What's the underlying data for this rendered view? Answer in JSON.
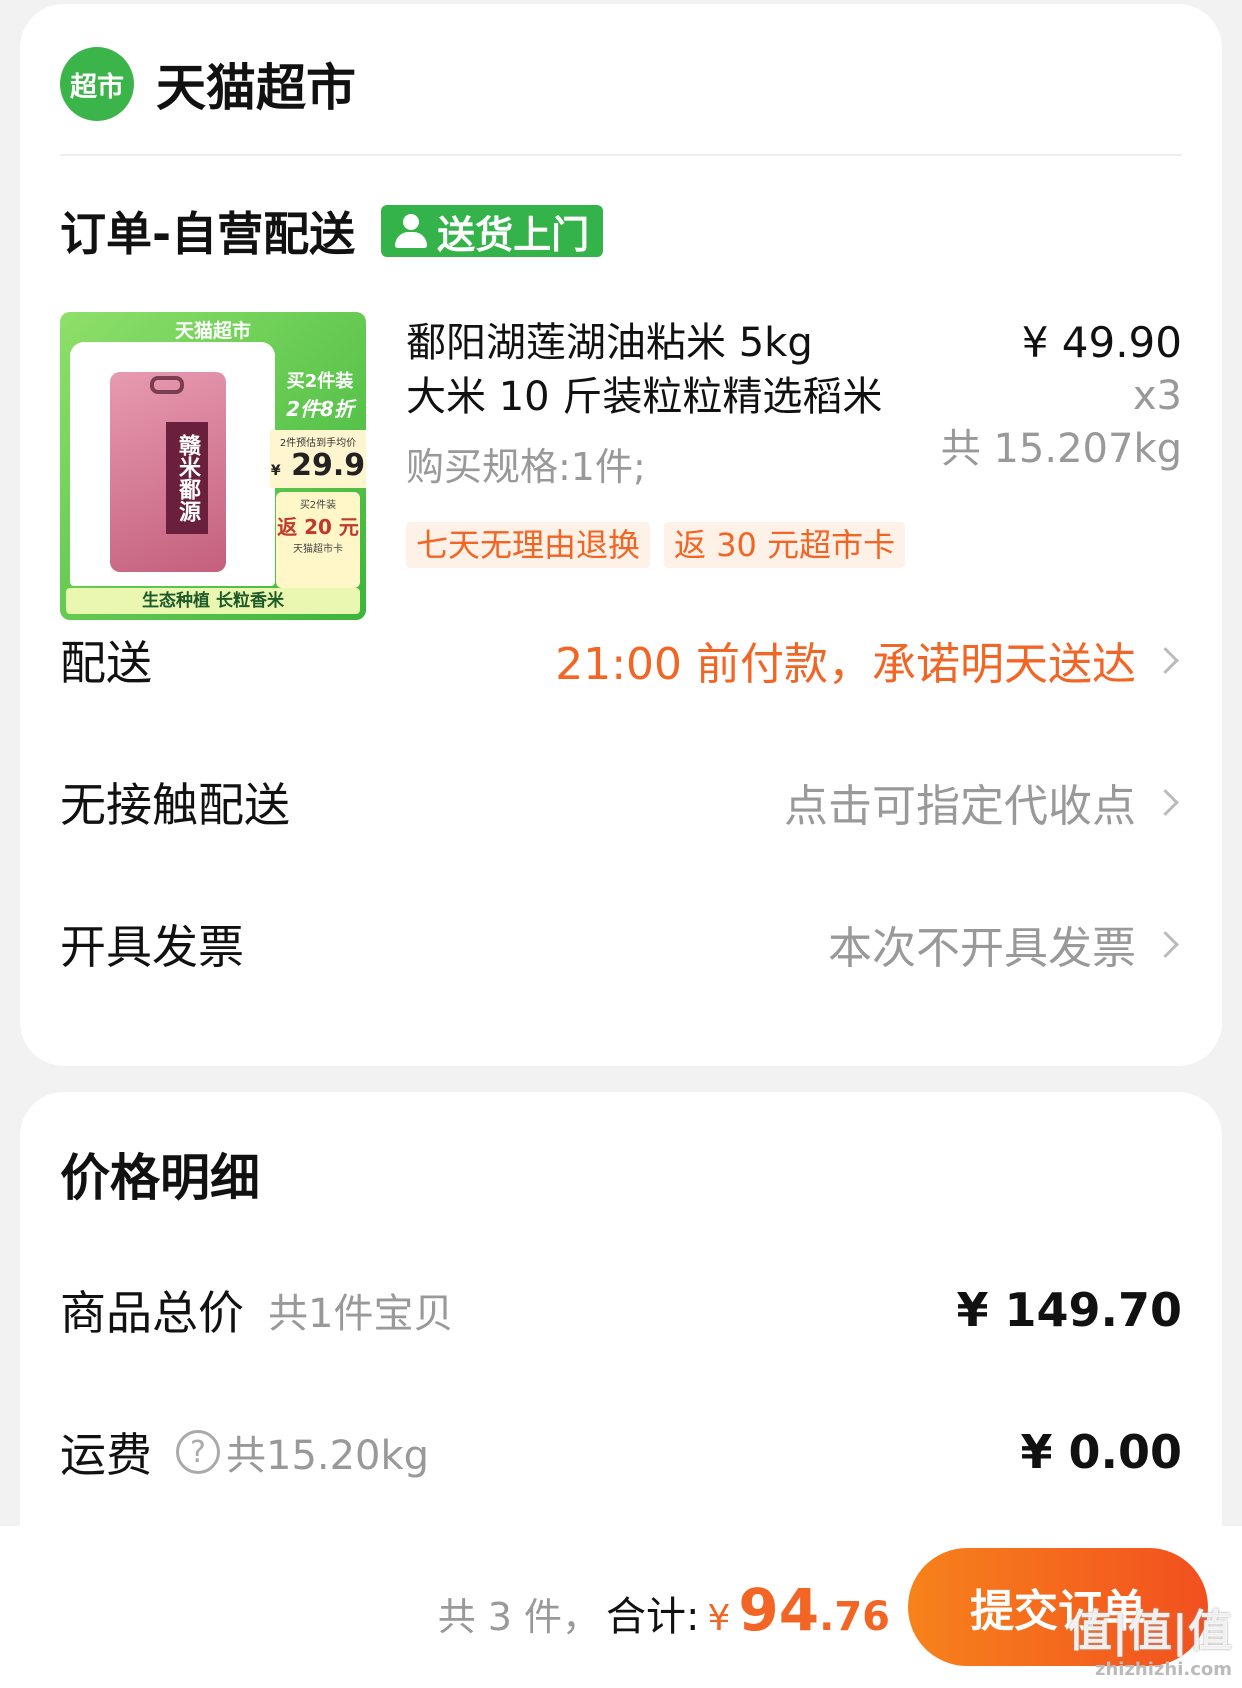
{
  "store": {
    "logo_text": "超市",
    "name": "天猫超市"
  },
  "order": {
    "title": "订单-自营配送",
    "delivery_badge": "送货上门"
  },
  "product": {
    "title_line1": "鄱阳湖莲湖油粘米 5kg",
    "title_line2": "大米 10 斤装粒粒精选稻米",
    "spec": "购买规格:1件;",
    "unit_price": "¥ 49.90",
    "quantity": "x3",
    "total_weight": "共 15.207kg",
    "tags": [
      "七天无理由退换",
      "返 30 元超市卡"
    ],
    "image": {
      "top_text": "天猫超市",
      "promo_line1": "买2件装",
      "promo_line2": "2件8折",
      "price_caption": "2件预估到手均价",
      "price_yen": "¥",
      "price_value": "29.9",
      "rebate_line1": "买2件装",
      "rebate_line2": "返 20 元",
      "rebate_line3": "天猫超市卡",
      "bag_label": "赣米鄱源",
      "bottom_text": "生态种植 长粒香米"
    }
  },
  "rows": {
    "delivery_label": "配送",
    "delivery_value": "21:00 前付款，承诺明天送达",
    "contactless_label": "无接触配送",
    "contactless_value": "点击可指定代收点",
    "invoice_label": "开具发票",
    "invoice_value": "本次不开具发票"
  },
  "price_detail": {
    "title": "价格明细",
    "goods_label": "商品总价",
    "goods_sub": "共1件宝贝",
    "goods_amount": "¥ 149.70",
    "shipping_label": "运费",
    "shipping_help": "?",
    "shipping_sub": "共15.20kg",
    "shipping_amount": "¥ 0.00"
  },
  "bottom_bar": {
    "count": "共 3 件，",
    "total_label": "合计:",
    "yen": "¥",
    "total_int": "94",
    "total_dec": ".76",
    "submit_label": "提交订单",
    "watermark": "值|值|值",
    "watermark_url": "zhizhizhi.com"
  },
  "colors": {
    "brand_green": "#34b34a",
    "accent_orange": "#f26524"
  }
}
